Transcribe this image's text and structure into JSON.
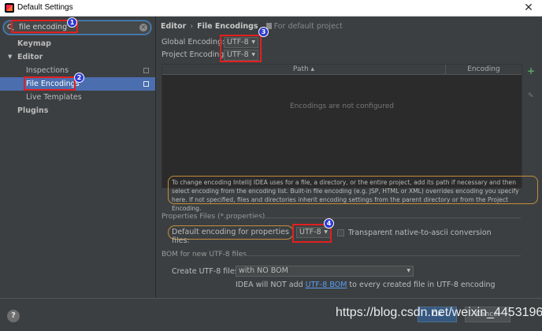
{
  "window": {
    "title": "Default Settings",
    "close": "✕"
  },
  "sidebar": {
    "search_value": "file encoding",
    "items": [
      {
        "label": "Keymap"
      },
      {
        "label": "Editor"
      },
      {
        "label": "Inspections"
      },
      {
        "label": "File Encodings"
      },
      {
        "label": "Live Templates"
      },
      {
        "label": "Plugins"
      }
    ]
  },
  "breadcrumb": {
    "root": "Editor",
    "sep": "›",
    "current": "File Encodings",
    "scope": "For default project"
  },
  "encodings": {
    "global_label": "Global Encoding:",
    "global_value": "UTF-8",
    "project_label": "Project Encoding:",
    "project_value": "UTF-8",
    "caret": "▼"
  },
  "table": {
    "col_path": "Path ▴",
    "col_encoding": "Encoding",
    "empty": "Encodings are not configured"
  },
  "info_text": "To change encoding IntelliJ IDEA uses for a file, a directory, or the entire project, add its path if necessary and then select encoding from the encoding list. Built-in file encoding (e.g. JSP, HTML or XML) overrides encoding you specify here. If not specified, files and directories inherit encoding settings from the parent directory or from the Project Encoding.",
  "properties": {
    "section": "Properties Files (*.properties)",
    "default_label": "Default encoding for properties files:",
    "default_value": "UTF-8",
    "transparent_label": "Transparent native-to-ascii conversion"
  },
  "bom": {
    "section": "BOM for new UTF-8 files",
    "create_label": "Create UTF-8 files:",
    "create_value": "with NO BOM",
    "note_before": "IDEA will NOT add ",
    "note_link": "UTF-8 BOM",
    "note_after": " to every created file in UTF-8 encoding"
  },
  "footer": {
    "help": "?",
    "ok": "OK",
    "cancel": "Cancel"
  },
  "markers": [
    "1",
    "2",
    "3",
    "4"
  ],
  "watermark": "https://blog.csdn.net/weixin_44531966",
  "colors": {
    "accent": "#4b6eaf",
    "marker": "#2d3bd1",
    "highlight": "#e02020",
    "note_border": "#c58e3a"
  }
}
